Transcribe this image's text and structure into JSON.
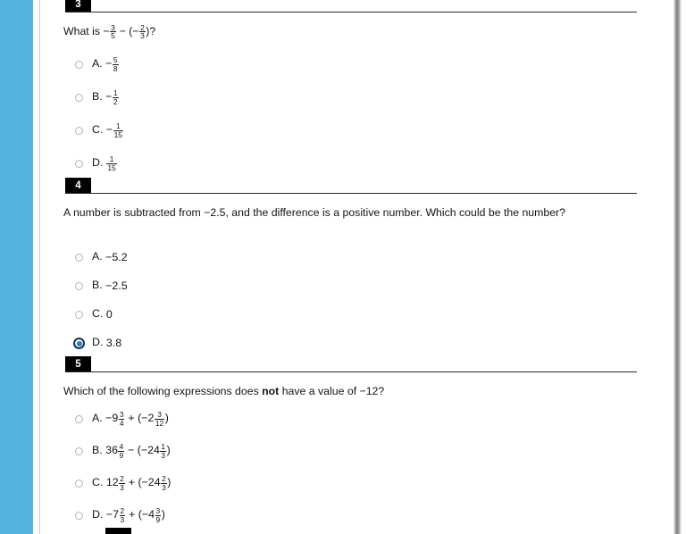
{
  "theme": {
    "rail_color": "#55b3e0",
    "badge_bg": "#000000",
    "badge_text": "#ffffff",
    "selected_radio_fill": "#1e7ec8",
    "selected_radio_ring": "#10305a",
    "rule_color": "#2b2b2b"
  },
  "questions": [
    {
      "number": "3",
      "prompt_parts": [
        {
          "type": "text",
          "value": "What is −"
        },
        {
          "type": "frac",
          "num": "3",
          "den": "5"
        },
        {
          "type": "text",
          "value": " − (−"
        },
        {
          "type": "frac",
          "num": "2",
          "den": "3"
        },
        {
          "type": "text",
          "value": ")?"
        }
      ],
      "prompt_plain": "What is −3/5 − (−2/3)?",
      "options": [
        {
          "letter": "A.",
          "selected": false,
          "parts": [
            {
              "type": "text",
              "value": "−"
            },
            {
              "type": "frac",
              "num": "5",
              "den": "8"
            }
          ],
          "plain": "A. −5/8"
        },
        {
          "letter": "B.",
          "selected": false,
          "parts": [
            {
              "type": "text",
              "value": "−"
            },
            {
              "type": "frac",
              "num": "1",
              "den": "2"
            }
          ],
          "plain": "B. −1/2"
        },
        {
          "letter": "C.",
          "selected": false,
          "parts": [
            {
              "type": "text",
              "value": "−"
            },
            {
              "type": "frac",
              "num": "1",
              "den": "15"
            }
          ],
          "plain": "C. −1/15"
        },
        {
          "letter": "D.",
          "selected": false,
          "parts": [
            {
              "type": "frac",
              "num": "1",
              "den": "15"
            }
          ],
          "plain": "D. 1/15"
        }
      ]
    },
    {
      "number": "4",
      "prompt_parts": [
        {
          "type": "text",
          "value": "A number is subtracted from −2.5, and the difference is a positive number. Which could be the number?"
        }
      ],
      "prompt_plain": "A number is subtracted from −2.5, and the difference is a positive number. Which could be the number?",
      "options": [
        {
          "letter": "A.",
          "selected": false,
          "parts": [
            {
              "type": "text",
              "value": "−5.2"
            }
          ],
          "plain": "A. −5.2"
        },
        {
          "letter": "B.",
          "selected": false,
          "parts": [
            {
              "type": "text",
              "value": "−2.5"
            }
          ],
          "plain": "B. −2.5"
        },
        {
          "letter": "C.",
          "selected": false,
          "parts": [
            {
              "type": "text",
              "value": "0"
            }
          ],
          "plain": "C. 0"
        },
        {
          "letter": "D.",
          "selected": true,
          "parts": [
            {
              "type": "text",
              "value": "3.8"
            }
          ],
          "plain": "D. 3.8"
        }
      ]
    },
    {
      "number": "5",
      "prompt_parts": [
        {
          "type": "text",
          "value": "Which of the following expressions does "
        },
        {
          "type": "bold",
          "value": "not"
        },
        {
          "type": "text",
          "value": " have a value of −12?"
        }
      ],
      "prompt_plain": "Which of the following expressions does not have a value of −12?",
      "options": [
        {
          "letter": "A.",
          "selected": false,
          "parts": [
            {
              "type": "text",
              "value": "−9"
            },
            {
              "type": "frac",
              "num": "3",
              "den": "4"
            },
            {
              "type": "text",
              "value": " + (−2"
            },
            {
              "type": "frac",
              "num": "3",
              "den": "12"
            },
            {
              "type": "text",
              "value": ")"
            }
          ],
          "plain": "A. −9 3/4 + (−2 3/12)"
        },
        {
          "letter": "B.",
          "selected": false,
          "parts": [
            {
              "type": "text",
              "value": "36"
            },
            {
              "type": "frac",
              "num": "4",
              "den": "9"
            },
            {
              "type": "text",
              "value": " − (−24"
            },
            {
              "type": "frac",
              "num": "1",
              "den": "3"
            },
            {
              "type": "text",
              "value": ")"
            }
          ],
          "plain": "B. 36 4/9 − (−24 1/3)"
        },
        {
          "letter": "C.",
          "selected": false,
          "parts": [
            {
              "type": "text",
              "value": "12"
            },
            {
              "type": "frac",
              "num": "2",
              "den": "3"
            },
            {
              "type": "text",
              "value": " + (−24"
            },
            {
              "type": "frac",
              "num": "2",
              "den": "3"
            },
            {
              "type": "text",
              "value": ")"
            }
          ],
          "plain": "C. 12 2/3 + (−24 2/3)"
        },
        {
          "letter": "D.",
          "selected": false,
          "parts": [
            {
              "type": "text",
              "value": "−7"
            },
            {
              "type": "frac",
              "num": "2",
              "den": "3"
            },
            {
              "type": "text",
              "value": " + (−4"
            },
            {
              "type": "frac",
              "num": "3",
              "den": "9"
            },
            {
              "type": "text",
              "value": ")"
            }
          ],
          "plain": "D. −7 2/3 + (−4 3/9)"
        }
      ]
    }
  ]
}
